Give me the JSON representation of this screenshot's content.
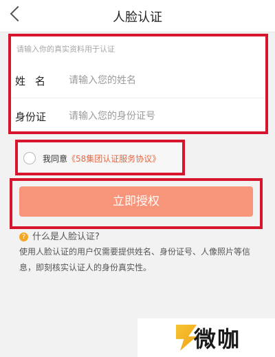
{
  "header": {
    "title": "人脸认证"
  },
  "form": {
    "hint": "请输入你的真实资料用于认证",
    "name": {
      "label": "姓名",
      "placeholder": "请输入您的姓名"
    },
    "id_card": {
      "label": "身份证",
      "placeholder": "请输入您的身份证号"
    }
  },
  "agreement": {
    "prefix": "我同意",
    "link": "《58集团认证服务协议》",
    "checked": false
  },
  "authorize_button": {
    "label": "立即授权"
  },
  "faq": {
    "question": "什么是人脸认证?",
    "answer": "使用人脸认证的用户仅需要提供姓名、身份证号、人像照片等信息，即刻核实认证人的身份真实性。"
  },
  "watermark": {
    "text": "微咖"
  },
  "colors": {
    "highlight_border": "#d6162c",
    "button": "#f6957a",
    "link": "#e8653e",
    "question_icon": "#f5a623"
  },
  "icons": {
    "back": "chevron-left-icon",
    "question": "question-mark-icon",
    "radio": "radio-unchecked-icon"
  }
}
